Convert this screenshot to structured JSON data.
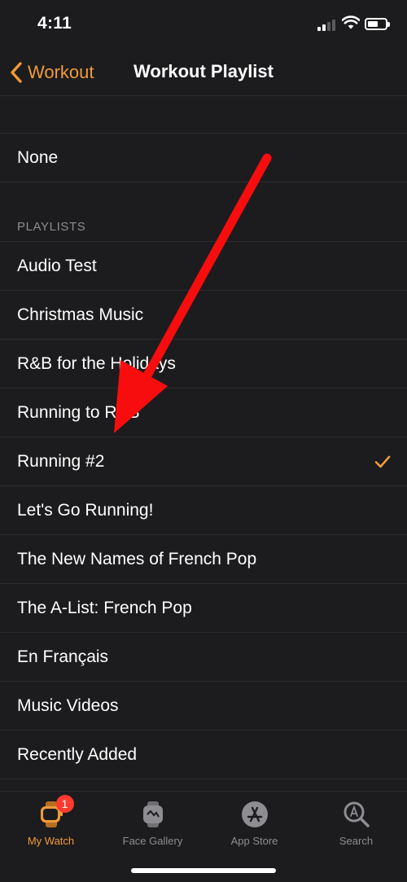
{
  "status_bar": {
    "time": "4:11"
  },
  "nav": {
    "back_label": "Workout",
    "title": "Workout Playlist"
  },
  "none_option": "None",
  "playlists_header": "PLAYLISTS",
  "playlists": [
    {
      "label": "Audio Test",
      "selected": false
    },
    {
      "label": "Christmas Music",
      "selected": false
    },
    {
      "label": "R&B for the Holidays",
      "selected": false
    },
    {
      "label": "Running to R&B",
      "selected": false
    },
    {
      "label": "Running #2",
      "selected": true
    },
    {
      "label": "Let's Go Running!",
      "selected": false
    },
    {
      "label": "The New Names of French Pop",
      "selected": false
    },
    {
      "label": "The A-List: French Pop",
      "selected": false
    },
    {
      "label": "En Français",
      "selected": false
    },
    {
      "label": "Music Videos",
      "selected": false
    },
    {
      "label": "Recently Added",
      "selected": false
    }
  ],
  "tabs": [
    {
      "label": "My Watch",
      "icon": "watch-icon",
      "active": true,
      "badge": "1"
    },
    {
      "label": "Face Gallery",
      "icon": "face-gallery-icon",
      "active": false
    },
    {
      "label": "App Store",
      "icon": "app-store-icon",
      "active": false
    },
    {
      "label": "Search",
      "icon": "search-icon",
      "active": false
    }
  ],
  "colors": {
    "accent": "#f19a38",
    "background": "#1c1c1e",
    "separator": "#2c2c2e",
    "secondary_text": "#8d8d92",
    "badge": "#ff3b30",
    "annotation_arrow": "#f70d0d"
  }
}
